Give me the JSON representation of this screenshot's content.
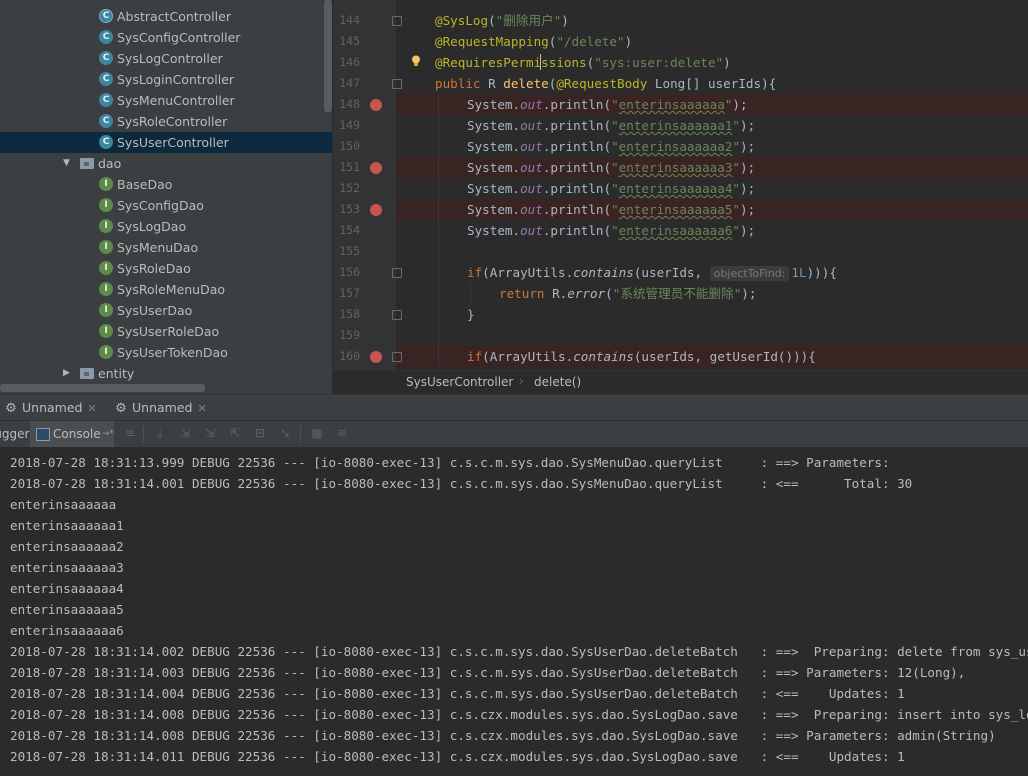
{
  "project_tree": {
    "items": [
      {
        "label": "AbstractController",
        "icon": "abstract-class-icon",
        "kind": "abstract",
        "glyph": "C"
      },
      {
        "label": "SysConfigController",
        "icon": "class-icon",
        "kind": "class",
        "glyph": "C"
      },
      {
        "label": "SysLogController",
        "icon": "class-icon",
        "kind": "class",
        "glyph": "C"
      },
      {
        "label": "SysLoginController",
        "icon": "class-icon",
        "kind": "class",
        "glyph": "C"
      },
      {
        "label": "SysMenuController",
        "icon": "class-icon",
        "kind": "class",
        "glyph": "C"
      },
      {
        "label": "SysRoleController",
        "icon": "class-icon",
        "kind": "class",
        "glyph": "C"
      },
      {
        "label": "SysUserController",
        "icon": "class-icon",
        "kind": "class",
        "glyph": "C",
        "selected": true
      },
      {
        "label": "dao",
        "icon": "folder-icon",
        "kind": "folder",
        "expanded": true
      },
      {
        "label": "BaseDao",
        "icon": "interface-icon",
        "kind": "iface",
        "glyph": "I"
      },
      {
        "label": "SysConfigDao",
        "icon": "interface-icon",
        "kind": "iface",
        "glyph": "I"
      },
      {
        "label": "SysLogDao",
        "icon": "interface-icon",
        "kind": "iface",
        "glyph": "I"
      },
      {
        "label": "SysMenuDao",
        "icon": "interface-icon",
        "kind": "iface",
        "glyph": "I"
      },
      {
        "label": "SysRoleDao",
        "icon": "interface-icon",
        "kind": "iface",
        "glyph": "I"
      },
      {
        "label": "SysRoleMenuDao",
        "icon": "interface-icon",
        "kind": "iface",
        "glyph": "I"
      },
      {
        "label": "SysUserDao",
        "icon": "interface-icon",
        "kind": "iface",
        "glyph": "I"
      },
      {
        "label": "SysUserRoleDao",
        "icon": "interface-icon",
        "kind": "iface",
        "glyph": "I"
      },
      {
        "label": "SysUserTokenDao",
        "icon": "interface-icon",
        "kind": "iface",
        "glyph": "I"
      },
      {
        "label": "entity",
        "icon": "folder-icon",
        "kind": "folder",
        "expanded": false
      }
    ]
  },
  "editor": {
    "lines": [
      {
        "num": "144",
        "breakpoint": false,
        "fold": true,
        "parts": [
          [
            "ann",
            "@SysLog"
          ],
          [
            "",
            "("
          ],
          [
            "str",
            "\"删除用户\""
          ],
          [
            "",
            ")"
          ]
        ]
      },
      {
        "num": "145",
        "breakpoint": false,
        "fold": false,
        "parts": [
          [
            "ann",
            "@RequestMapping"
          ],
          [
            "",
            "("
          ],
          [
            "str",
            "\"/delete\""
          ],
          [
            "",
            ")"
          ]
        ]
      },
      {
        "num": "146",
        "breakpoint": false,
        "fold": false,
        "parts": [
          [
            "ann",
            "@RequiresPermissions"
          ],
          [
            "",
            "("
          ],
          [
            "str",
            "\"sys:user:delete\""
          ],
          [
            "",
            ")"
          ]
        ]
      },
      {
        "num": "147",
        "breakpoint": false,
        "fold": true,
        "parts": [
          [
            "kw",
            "public "
          ],
          [
            "",
            "R "
          ],
          [
            "fn",
            "delete"
          ],
          [
            "",
            "("
          ],
          [
            "ann",
            "@RequestBody "
          ],
          [
            "",
            "Long[] userIds){"
          ]
        ]
      },
      {
        "num": "148",
        "breakpoint": true,
        "indent": 1,
        "parts": [
          [
            "",
            "System."
          ],
          [
            "st",
            "out"
          ],
          [
            "",
            ".println("
          ],
          [
            "strw",
            "\"enterinsaaaaaa\""
          ],
          [
            "",
            ");"
          ]
        ]
      },
      {
        "num": "149",
        "breakpoint": false,
        "indent": 1,
        "parts": [
          [
            "",
            "System."
          ],
          [
            "st",
            "out"
          ],
          [
            "",
            ".println("
          ],
          [
            "strw",
            "\"enterinsaaaaaa1\""
          ],
          [
            "",
            ");"
          ]
        ]
      },
      {
        "num": "150",
        "breakpoint": false,
        "indent": 1,
        "parts": [
          [
            "",
            "System."
          ],
          [
            "st",
            "out"
          ],
          [
            "",
            ".println("
          ],
          [
            "strw",
            "\"enterinsaaaaaa2\""
          ],
          [
            "",
            ");"
          ]
        ]
      },
      {
        "num": "151",
        "breakpoint": true,
        "indent": 1,
        "parts": [
          [
            "",
            "System."
          ],
          [
            "st",
            "out"
          ],
          [
            "",
            ".println("
          ],
          [
            "strw",
            "\"enterinsaaaaaa3\""
          ],
          [
            "",
            ");"
          ]
        ]
      },
      {
        "num": "152",
        "breakpoint": false,
        "indent": 1,
        "parts": [
          [
            "",
            "System."
          ],
          [
            "st",
            "out"
          ],
          [
            "",
            ".println("
          ],
          [
            "strw",
            "\"enterinsaaaaaa4\""
          ],
          [
            "",
            ");"
          ]
        ]
      },
      {
        "num": "153",
        "breakpoint": true,
        "indent": 1,
        "parts": [
          [
            "",
            "System."
          ],
          [
            "st",
            "out"
          ],
          [
            "",
            ".println("
          ],
          [
            "strw",
            "\"enterinsaaaaaa5\""
          ],
          [
            "",
            ");"
          ]
        ]
      },
      {
        "num": "154",
        "breakpoint": false,
        "indent": 1,
        "parts": [
          [
            "",
            "System."
          ],
          [
            "st",
            "out"
          ],
          [
            "",
            ".println("
          ],
          [
            "strw",
            "\"enterinsaaaaaa6\""
          ],
          [
            "",
            ");"
          ]
        ]
      },
      {
        "num": "155",
        "breakpoint": false,
        "indent": 1,
        "parts": []
      },
      {
        "num": "156",
        "breakpoint": false,
        "indent": 1,
        "fold": true,
        "parts": [
          [
            "kw",
            "if"
          ],
          [
            "",
            "(ArrayUtils."
          ],
          [
            "it",
            "contains"
          ],
          [
            "",
            "(userIds, "
          ],
          [
            "hint",
            "objectToFind:"
          ],
          [
            "num",
            "1L"
          ],
          [
            "",
            "))){"
          ]
        ]
      },
      {
        "num": "157",
        "breakpoint": false,
        "indent": 2,
        "parts": [
          [
            "kw",
            "return "
          ],
          [
            "",
            "R."
          ],
          [
            "it",
            "error"
          ],
          [
            "",
            "("
          ],
          [
            "str",
            "\"系统管理员不能删除\""
          ],
          [
            "",
            ");"
          ]
        ]
      },
      {
        "num": "158",
        "breakpoint": false,
        "indent": 1,
        "fold": true,
        "parts": [
          [
            "",
            "}"
          ]
        ]
      },
      {
        "num": "159",
        "breakpoint": false,
        "indent": 1,
        "parts": []
      },
      {
        "num": "160",
        "breakpoint": true,
        "indent": 1,
        "fold": true,
        "parts": [
          [
            "kw",
            "if"
          ],
          [
            "",
            "(ArrayUtils."
          ],
          [
            "it",
            "contains"
          ],
          [
            "",
            "(userIds, getUserId())){"
          ]
        ]
      }
    ]
  },
  "breadcrumb": {
    "items": [
      "SysUserController",
      "delete()"
    ]
  },
  "debug": {
    "tabs": [
      {
        "label": "Unnamed"
      },
      {
        "label": "Unnamed"
      }
    ],
    "toolbar": {
      "debugger_label": "Debugger",
      "console_label": "Console",
      "console_suffix": "→*"
    }
  },
  "console": {
    "lines": [
      "2018-07-28 18:31:13.999 DEBUG 22536 --- [io-8080-exec-13] c.s.c.m.sys.dao.SysMenuDao.queryList     : ==> Parameters: ",
      "2018-07-28 18:31:14.001 DEBUG 22536 --- [io-8080-exec-13] c.s.c.m.sys.dao.SysMenuDao.queryList     : <==      Total: 30",
      "enterinsaaaaaa",
      "enterinsaaaaaa1",
      "enterinsaaaaaa2",
      "enterinsaaaaaa3",
      "enterinsaaaaaa4",
      "enterinsaaaaaa5",
      "enterinsaaaaaa6",
      "2018-07-28 18:31:14.002 DEBUG 22536 --- [io-8080-exec-13] c.s.c.m.sys.dao.SysUserDao.deleteBatch   : ==>  Preparing: delete from sys_user where user_id in ( ? ) ",
      "2018-07-28 18:31:14.003 DEBUG 22536 --- [io-8080-exec-13] c.s.c.m.sys.dao.SysUserDao.deleteBatch   : ==> Parameters: 12(Long), ",
      "2018-07-28 18:31:14.004 DEBUG 22536 --- [io-8080-exec-13] c.s.c.m.sys.dao.SysUserDao.deleteBatch   : <==    Updates: 1",
      "2018-07-28 18:31:14.008 DEBUG 22536 --- [io-8080-exec-13] c.s.czx.modules.sys.dao.SysLogDao.save   : ==>  Preparing: insert into sys_log",
      "2018-07-28 18:31:14.008 DEBUG 22536 --- [io-8080-exec-13] c.s.czx.modules.sys.dao.SysLogDao.save   : ==> Parameters: admin(String)",
      "2018-07-28 18:31:14.011 DEBUG 22536 --- [io-8080-exec-13] c.s.czx.modules.sys.dao.SysLogDao.save   : <==    Updates: 1"
    ]
  },
  "colors": {
    "breakpoint": "#c75450",
    "annotation": "#bbb529",
    "string": "#6a8759",
    "keyword": "#cc7832",
    "selection": "#0d293e"
  }
}
